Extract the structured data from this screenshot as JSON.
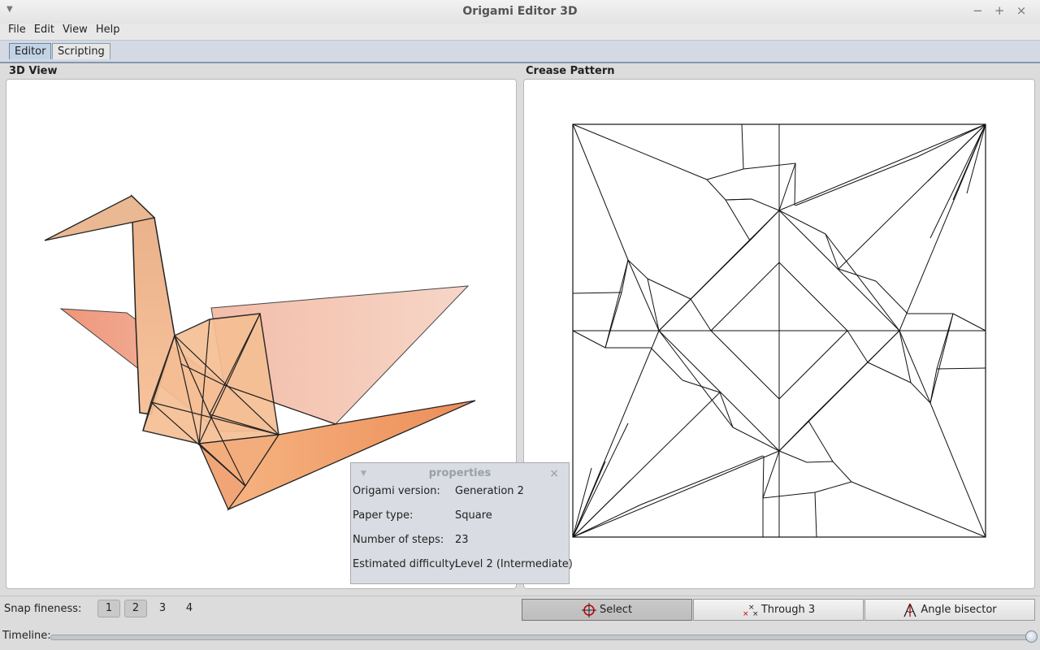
{
  "window": {
    "title": "Origami Editor 3D"
  },
  "menu": [
    "File",
    "Edit",
    "View",
    "Help"
  ],
  "tabs": [
    {
      "label": "Editor",
      "active": true
    },
    {
      "label": "Scripting",
      "active": false
    }
  ],
  "panels": {
    "left_title": "3D View",
    "right_title": "Crease Pattern"
  },
  "properties": {
    "title": "properties",
    "rows": [
      {
        "key": "Origami version:",
        "value": "Generation 2"
      },
      {
        "key": "Paper type:",
        "value": "Square"
      },
      {
        "key": "Number of steps:",
        "value": "23"
      },
      {
        "key": "Estimated difficulty:",
        "value": "Level 2 (Intermediate)"
      }
    ]
  },
  "snap": {
    "label": "Snap fineness:",
    "options": [
      "1",
      "2",
      "3",
      "4"
    ],
    "selected": [
      "1",
      "2"
    ]
  },
  "tools": [
    {
      "label": "Select",
      "icon": "crosshair-icon",
      "active": true
    },
    {
      "label": "Through 3",
      "icon": "three-points-icon",
      "active": false
    },
    {
      "label": "Angle bisector",
      "icon": "angle-bisector-icon",
      "active": false
    }
  ],
  "timeline": {
    "label": "Timeline:",
    "position": 1.0
  },
  "colors": {
    "paper_light": "#f8d8c8",
    "paper_dark": "#ef9a70",
    "tab_active": "#c3d3e6"
  }
}
